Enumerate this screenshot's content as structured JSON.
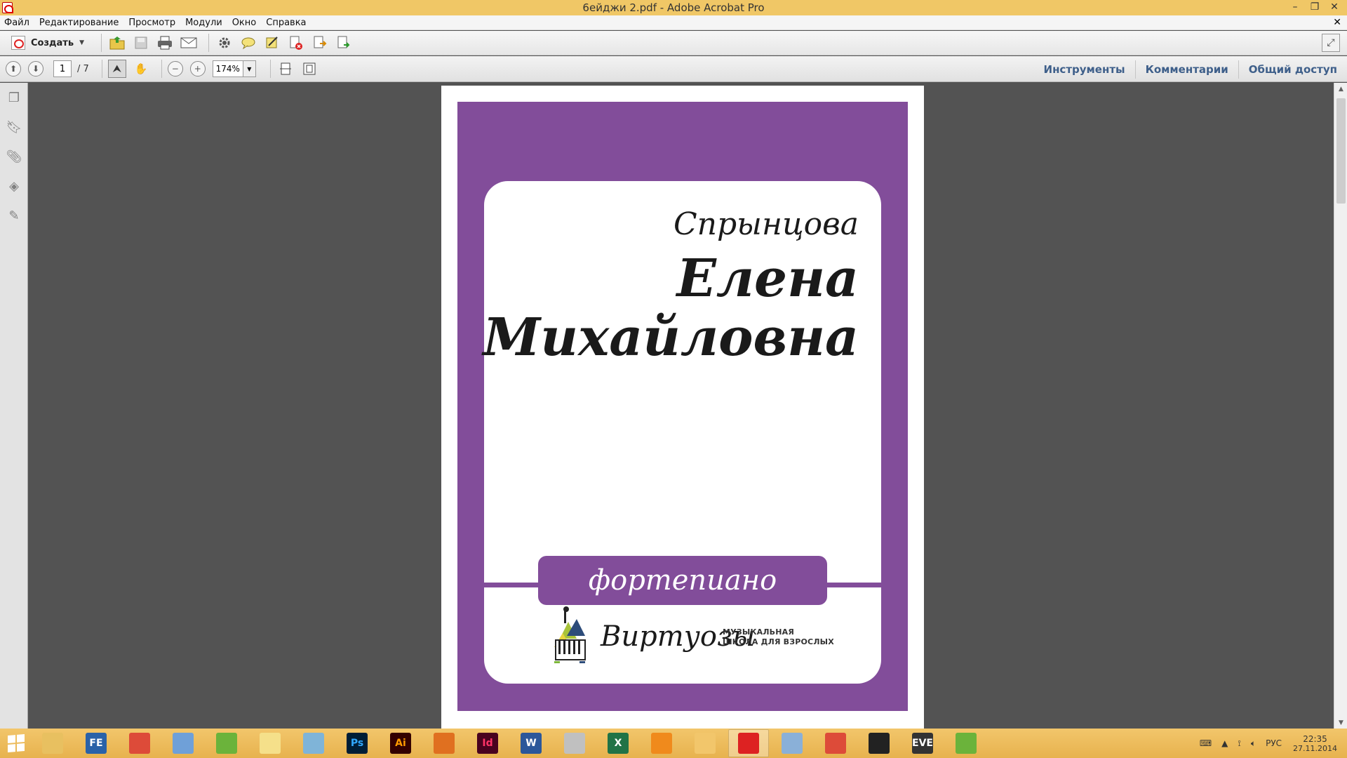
{
  "window": {
    "title": "6ейджи 2.pdf - Adobe Acrobat Pro",
    "minimize": "–",
    "restore": "❐",
    "close": "✕"
  },
  "menu": {
    "items": [
      "Файл",
      "Редактирование",
      "Просмотр",
      "Модули",
      "Окно",
      "Справка"
    ],
    "close": "✕"
  },
  "toolbar": {
    "create_label": "Создать",
    "caret": "▼",
    "icons": [
      "open-folder-icon",
      "save-icon",
      "print-icon",
      "email-icon",
      "settings-icon",
      "comment-icon",
      "sign-icon",
      "delete-page-icon",
      "export-icon",
      "combine-icon"
    ]
  },
  "navigation": {
    "current_page": "1",
    "total_pages": "/ 7",
    "zoom": "174%"
  },
  "right_tabs": [
    "Инструменты",
    "Комментарии",
    "Общий доступ"
  ],
  "badge": {
    "surname": "Спрынцова",
    "first_name": "Елена",
    "patronymic": "Михайловна",
    "instrument": "фортепиано",
    "logo_name": "Виртуозы",
    "logo_sub1": "МУЗЫКАЛЬНАЯ",
    "logo_sub2": "ШКОЛА ДЛЯ ВЗРОСЛЫХ",
    "color": "#824d9a"
  },
  "taskbar": {
    "apps": [
      {
        "name": "file-explorer",
        "label": "",
        "color": "#e8c060"
      },
      {
        "name": "fe-app",
        "label": "FE",
        "color": "#2a62a8"
      },
      {
        "name": "chrome",
        "label": "",
        "color": "#dd4b39"
      },
      {
        "name": "calculator",
        "label": "",
        "color": "#6fa0d8"
      },
      {
        "name": "leaf-app",
        "label": "",
        "color": "#6bb33b"
      },
      {
        "name": "folder-app",
        "label": "",
        "color": "#f5e08a"
      },
      {
        "name": "pen-app",
        "label": "",
        "color": "#7fb4d8"
      },
      {
        "name": "photoshop",
        "label": "Ps",
        "color": "#001e36"
      },
      {
        "name": "illustrator",
        "label": "Ai",
        "color": "#330000"
      },
      {
        "name": "pencil-app",
        "label": "",
        "color": "#e07020"
      },
      {
        "name": "indesign",
        "label": "Id",
        "color": "#49021f"
      },
      {
        "name": "word",
        "label": "W",
        "color": "#2b579a"
      },
      {
        "name": "paint-app",
        "label": "",
        "color": "#c0c0c0"
      },
      {
        "name": "excel",
        "label": "X",
        "color": "#217346"
      },
      {
        "name": "orange-app",
        "label": "",
        "color": "#f08a1c"
      },
      {
        "name": "figure-app",
        "label": "",
        "color": "#f2c66b"
      },
      {
        "name": "acrobat",
        "label": "",
        "color": "#d22"
      },
      {
        "name": "brush-app",
        "label": "",
        "color": "#8ab0d8"
      },
      {
        "name": "chrome2",
        "label": "",
        "color": "#dd4b39"
      },
      {
        "name": "list-app",
        "label": "",
        "color": "#222"
      },
      {
        "name": "eve-app",
        "label": "EVE",
        "color": "#333"
      },
      {
        "name": "leaf-app2",
        "label": "",
        "color": "#6bb33b"
      }
    ],
    "tray_lang": "РУС",
    "time": "22:35",
    "date": "27.11.2014"
  }
}
